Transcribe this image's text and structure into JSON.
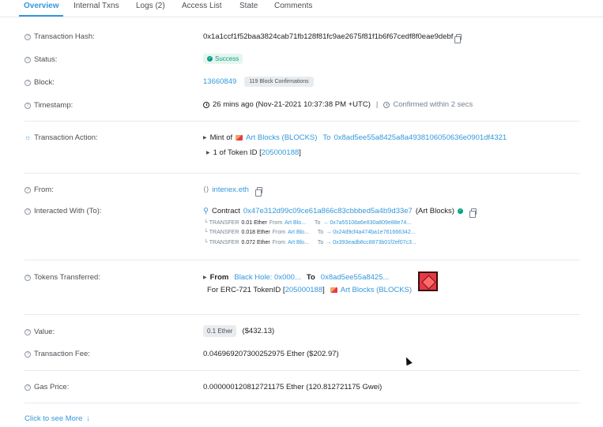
{
  "tabs": [
    "Overview",
    "Internal Txns",
    "Logs (2)",
    "Access List",
    "State",
    "Comments"
  ],
  "fields": {
    "tx_hash": {
      "label": "Transaction Hash:",
      "value": "0x1a1ccf1f52baa3824cab71fb128f81fc9ae2675f81f1b6f67cedf8f0eae9debf"
    },
    "status": {
      "label": "Status:",
      "value": "Success"
    },
    "block": {
      "label": "Block:",
      "value": "13660849",
      "confirmations": "119 Block Confirmations"
    },
    "timestamp": {
      "label": "Timestamp:",
      "value": "26 mins ago (Nov-21-2021 10:37:38 PM +UTC)",
      "separator": "|",
      "confirmed": "Confirmed within 2 secs"
    },
    "action": {
      "label": "Transaction Action:",
      "mint_of": "Mint of",
      "collection": "Art Blocks (BLOCKS)",
      "to_label": "To",
      "to_address": "0x8ad5ee55a8425a8a4938106050636e0901df4321",
      "token_prefix": "1 of Token ID [",
      "token_id": "205000188",
      "token_suffix": "]"
    },
    "from": {
      "label": "From:",
      "value": "intenex.eth"
    },
    "interacted": {
      "label": "Interacted With (To):",
      "contract_label": "Contract",
      "contract_address": "0x47e312d99c09ce61a866c83cbbbed5a4b9d33e7",
      "contract_name": "(Art Blocks)",
      "transfers": [
        {
          "prefix": "└ TRANSFER",
          "amount": "0.01 Ether",
          "from_label": "From",
          "from": "Art Blo...",
          "to_label": "To",
          "to": "→ 0x7a55108a6e830a809e88e74..."
        },
        {
          "prefix": "└ TRANSFER",
          "amount": "0.018 Ether",
          "from_label": "From",
          "from": "Art Blo...",
          "to_label": "To",
          "to": "→ 0x24d9cf4a474ba1e761666342..."
        },
        {
          "prefix": "└ TRANSFER",
          "amount": "0.072 Ether",
          "from_label": "From",
          "from": "Art Blo...",
          "to_label": "To",
          "to": "→ 0x393eadb8cc8873b01f2ef07c3..."
        }
      ]
    },
    "tokens": {
      "label": "Tokens Transferred:",
      "from_label": "From",
      "from": "Black Hole: 0x000...",
      "to_label": "To",
      "to": "0x8ad5ee55a8425...",
      "for_text": "For ERC-721 TokenID [",
      "token_id": "205000188",
      "close": "]",
      "collection": "Art Blocks (BLOCKS)"
    },
    "value": {
      "label": "Value:",
      "badge": "0.1 Ether",
      "usd": "($432.13)"
    },
    "fee": {
      "label": "Transaction Fee:",
      "value": "0.046969207300252975 Ether ($202.97)"
    },
    "gas": {
      "label": "Gas Price:",
      "value": "0.000000120812721175 Ether (120.812721175 Gwei)"
    }
  },
  "more": {
    "label": "Click to see More",
    "arrow": "↓"
  },
  "colors": {
    "link": "#3498db",
    "success": "#00a186",
    "muted": "#77838f"
  }
}
